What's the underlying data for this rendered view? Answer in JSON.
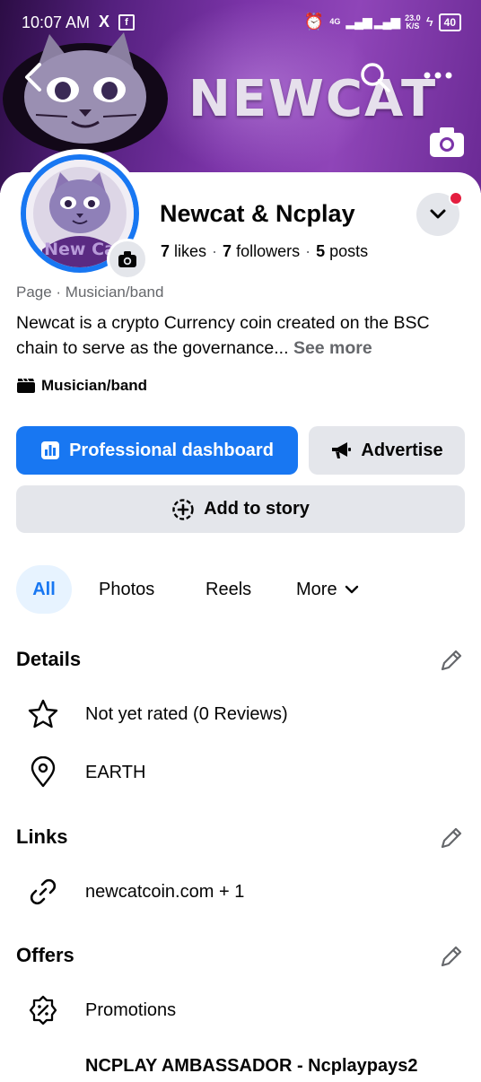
{
  "status_bar": {
    "time": "10:07 AM",
    "x_icon": "X",
    "network": "4G",
    "speed_value": "23.0",
    "speed_unit": "K/S",
    "battery": "40"
  },
  "cover": {
    "brand_text": "NEWCAT"
  },
  "profile": {
    "name": "Newcat & Ncplay",
    "likes_count": "7",
    "likes_label": "likes",
    "followers_count": "7",
    "followers_label": "followers",
    "posts_count": "5",
    "posts_label": "posts",
    "avatar_text": "New Ca"
  },
  "category_line": "Page · Musician/band",
  "bio": {
    "text": "Newcat is a crypto Currency  coin created on the BSC chain to serve as the governance... ",
    "see_more": "See more"
  },
  "page_type": "Musician/band",
  "actions": {
    "dashboard_label": "Professional dashboard",
    "advertise_label": "Advertise",
    "story_label": "Add to story"
  },
  "tabs": {
    "all": "All",
    "photos": "Photos",
    "reels": "Reels",
    "more": "More"
  },
  "details": {
    "title": "Details",
    "rating": "Not yet rated (0 Reviews)",
    "location": "EARTH"
  },
  "links": {
    "title": "Links",
    "website": "newcatcoin.com + 1"
  },
  "offers": {
    "title": "Offers",
    "promotions": "Promotions",
    "promo_name": "NCPLAY AMBASSADOR  - Ncplaypays2"
  },
  "colors": {
    "accent": "#1877f2",
    "button_gray": "#e4e6eb",
    "tab_active_bg": "#e7f3ff",
    "cover_purple": "#7b34a8",
    "notification_red": "#e41e3f"
  }
}
